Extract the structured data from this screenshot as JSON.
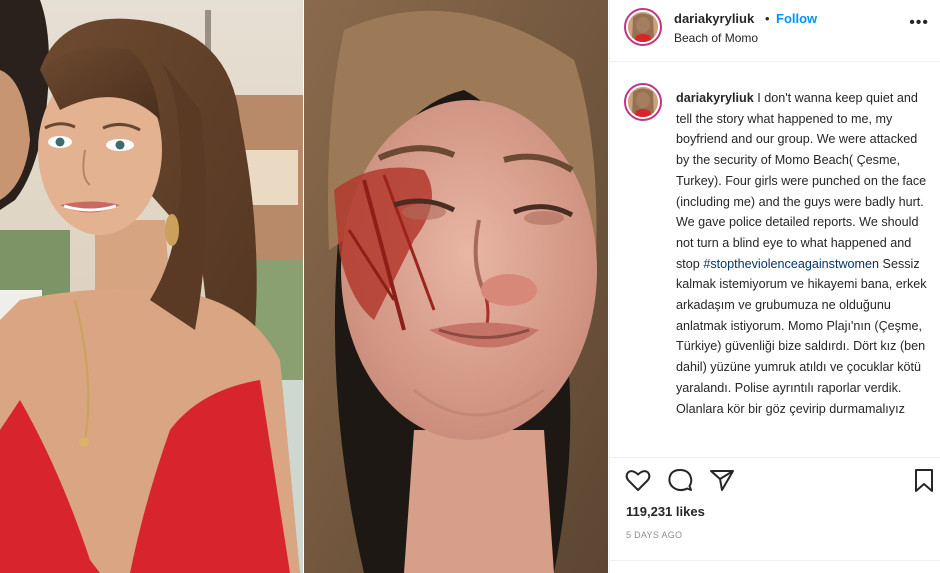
{
  "post": {
    "username": "dariakyryliuk",
    "dot": "•",
    "follow_label": "Follow",
    "location": "Beach of Momo",
    "more_label": "•••",
    "caption_text_1": " I don't wanna keep quiet and tell the story what happened to me, my boyfriend and our group. We were attacked by the security of Momo Beach( Çesme, Turkey). Four girls were punched on the face (including me) and the guys were badly hurt. We gave police detailed reports. We should not turn a blind eye to what happened and stop ",
    "hashtag": "#stoptheviolenceagainstwomen",
    "caption_text_2": " Sessiz kalmak istemiyorum ve hikayemi bana, erkek arkadaşım ve grubumuza ne olduğunu anlatmak istiyorum. Momo Plajı'nın (Çeşme, Türkiye) güvenliği bize saldırdı. Dört kız (ben dahil) yüzüne yumruk atıldı ve çocuklar kötü yaralandı. Polise ayrıntılı raporlar verdik. Olanlara kör bir göz çevirip durmamalıyız",
    "likes": "119,231 likes",
    "time": "5 DAYS AGO"
  },
  "icons": {
    "like": "heart-icon",
    "comment": "comment-bubble-icon",
    "share": "paper-plane-icon",
    "save": "bookmark-icon",
    "more": "more-dots-icon"
  },
  "colors": {
    "follow": "#0095f6",
    "hashtag": "#00376b",
    "text": "#262626",
    "muted": "#8e8e8e",
    "avatar_ring": "#c13584",
    "dress": "#d8242c"
  }
}
